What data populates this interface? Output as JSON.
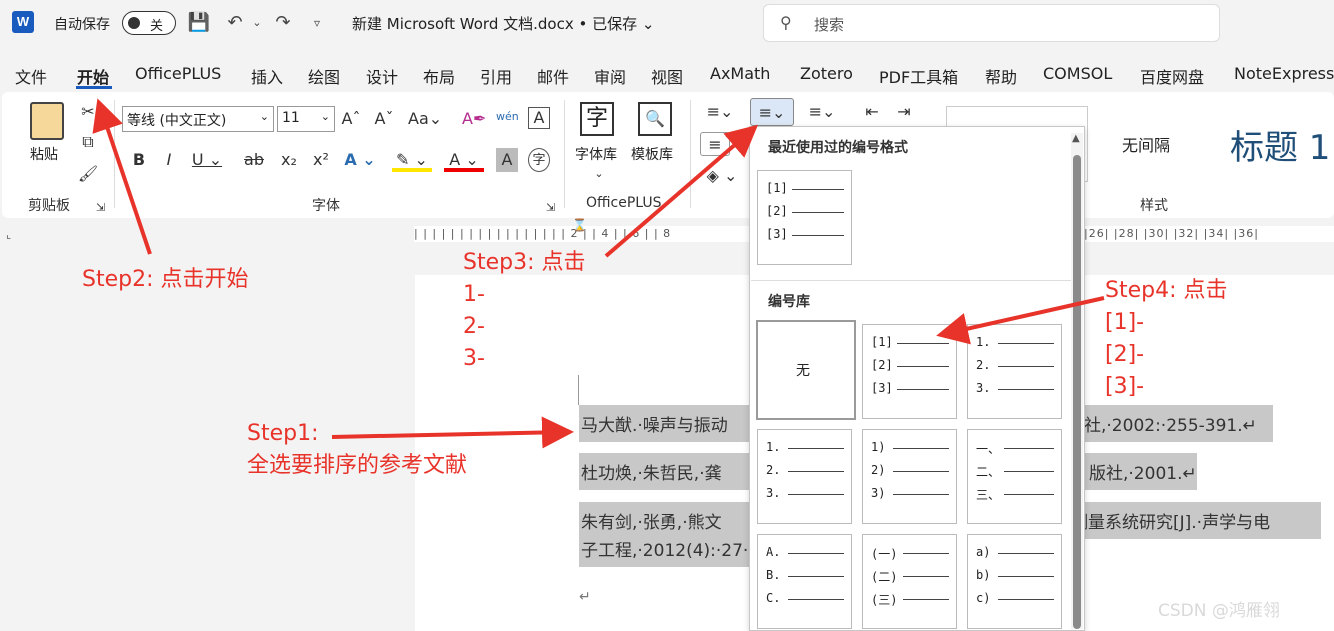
{
  "titlebar": {
    "app_logo": "W",
    "autosave_label": "自动保存",
    "autosave_state": "关",
    "doc_title": "新建 Microsoft Word 文档.docx • 已保存 ⌄",
    "search_placeholder": "搜索"
  },
  "tabs": [
    "文件",
    "开始",
    "OfficePLUS",
    "插入",
    "绘图",
    "设计",
    "布局",
    "引用",
    "邮件",
    "审阅",
    "视图",
    "AxMath",
    "Zotero",
    "PDF工具箱",
    "帮助",
    "COMSOL",
    "百度网盘",
    "NoteExpress"
  ],
  "active_tab": "开始",
  "ribbon": {
    "clipboard": {
      "paste": "粘贴",
      "group": "剪贴板"
    },
    "font": {
      "family": "等线 (中文正文)",
      "size": "11",
      "group": "字体"
    },
    "officeplus": {
      "font_lib": "字体库",
      "template_lib": "模板库",
      "group": "OfficePLUS"
    },
    "styles": {
      "no_spacing": "无间隔",
      "heading1": "标题 1",
      "group": "样式"
    }
  },
  "ruler": {
    "ticks": "| | | | | | | | | | | | | | | | | 2 | | 4 | | 6 | | 8",
    "ticks_right": "|26| |28| |30| |32| |34| |36|"
  },
  "document": {
    "lines": [
      "马大猷.·噪声与振动",
      "杜功焕,·朱哲民,·龚",
      "朱有剑,·张勇,·熊文",
      "子工程,·2012(4):·27·"
    ],
    "lines_right": [
      "版社,·2002:·255-391.↵",
      "版社,·2001.↵",
      "测量系统研究[J].·声学与电"
    ],
    "end_mark": "↵"
  },
  "dropdown": {
    "recent_title": "最近使用过的编号格式",
    "library_title": "编号库",
    "recent": [
      "[1]",
      "[2]",
      "[3]"
    ],
    "none_label": "无",
    "library": [
      [
        "[1]",
        "[2]",
        "[3]"
      ],
      [
        "1.",
        "2.",
        "3."
      ],
      [
        "1.",
        "2.",
        "3."
      ],
      [
        "1)",
        "2)",
        "3)"
      ],
      [
        "一、",
        "二、",
        "三、"
      ],
      [
        "A.",
        "B.",
        "C."
      ],
      [
        "(一)",
        "(二)",
        "(三)"
      ],
      [
        "a)",
        "b)",
        "c)"
      ]
    ]
  },
  "annotations": {
    "step1_a": "Step1:",
    "step1_b": "全选要排序的参考文献",
    "step2": "Step2: 点击开始",
    "step3_a": "Step3: 点击",
    "step3_b": "1-",
    "step3_c": "2-",
    "step3_d": "3-",
    "step4_a": "Step4: 点击",
    "step4_b": "[1]-",
    "step4_c": "[2]-",
    "step4_d": "[3]-",
    "color": "#e8332a"
  },
  "watermark": "CSDN @鸿雁翎"
}
